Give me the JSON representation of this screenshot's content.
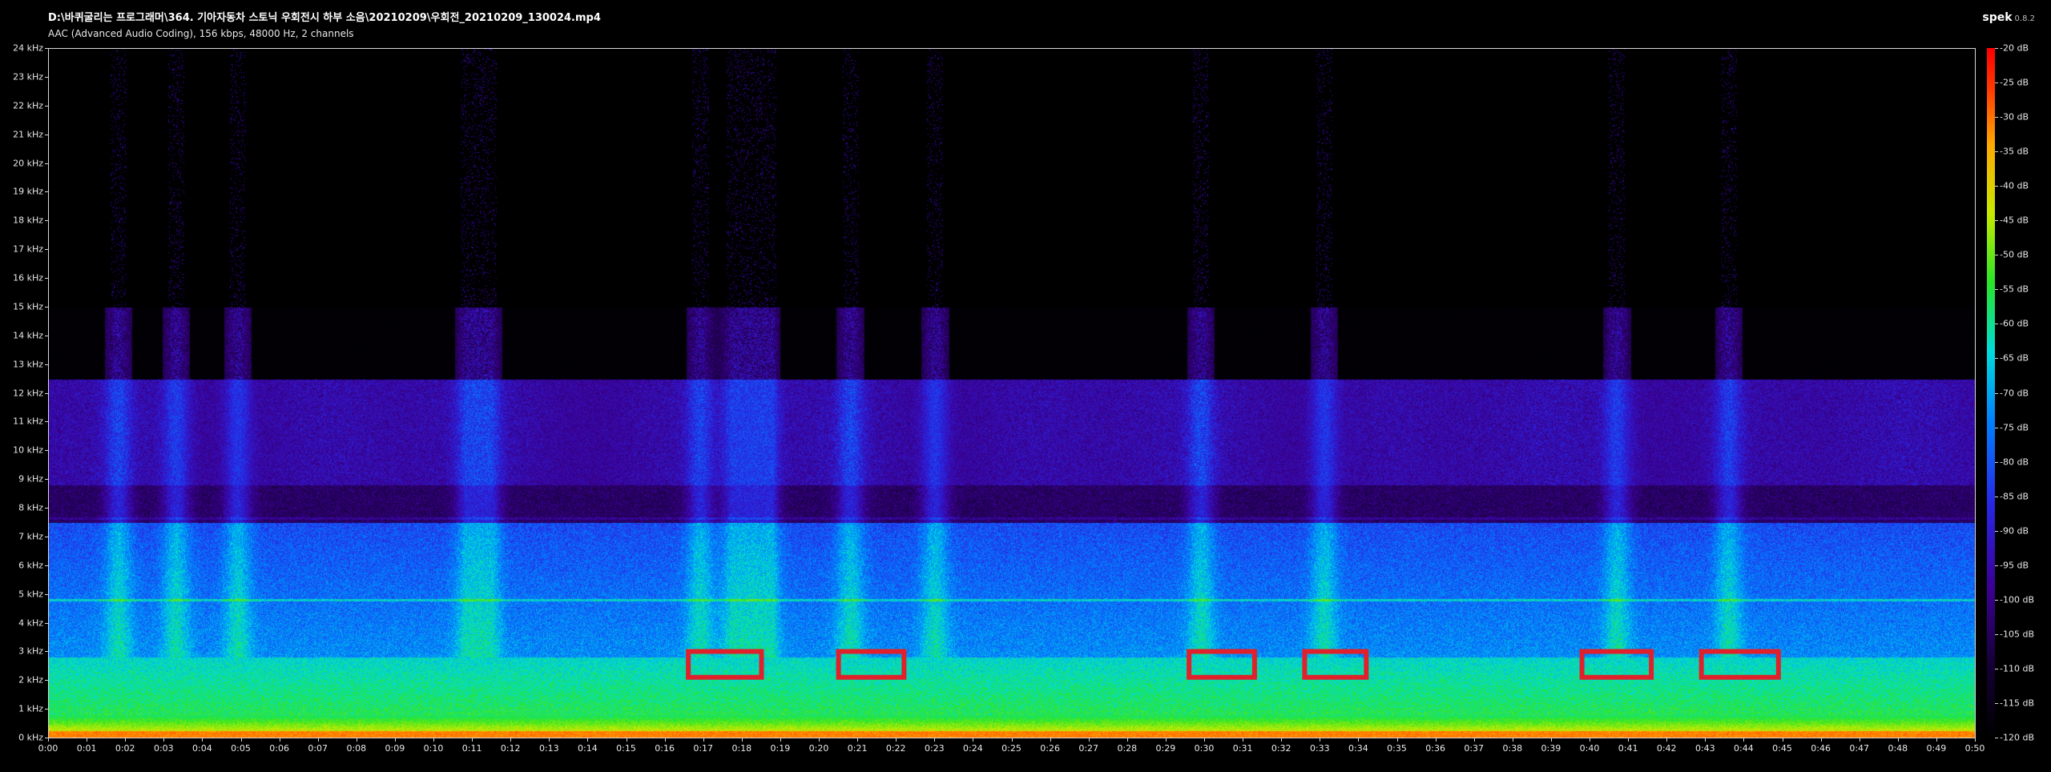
{
  "header": {
    "file_path": "D:\\바퀴굴리는 프로그래머\\364. 기아자동차 스토닉 우회전시 하부 소음\\20210209\\우회전_20210209_130024.mp4",
    "codec_info": "AAC (Advanced Audio Coding), 156 kbps, 48000 Hz, 2 channels"
  },
  "brand": {
    "name": "spek",
    "version": "0.8.2"
  },
  "chart_data": {
    "type": "heatmap",
    "title": "",
    "xlabel": "",
    "ylabel": "",
    "x_ticks": [
      "0:00",
      "0:01",
      "0:02",
      "0:03",
      "0:04",
      "0:05",
      "0:06",
      "0:07",
      "0:08",
      "0:09",
      "0:10",
      "0:11",
      "0:12",
      "0:13",
      "0:14",
      "0:15",
      "0:16",
      "0:17",
      "0:18",
      "0:19",
      "0:20",
      "0:21",
      "0:22",
      "0:23",
      "0:24",
      "0:25",
      "0:26",
      "0:27",
      "0:28",
      "0:29",
      "0:30",
      "0:31",
      "0:32",
      "0:33",
      "0:34",
      "0:35",
      "0:36",
      "0:37",
      "0:38",
      "0:39",
      "0:40",
      "0:41",
      "0:42",
      "0:43",
      "0:44",
      "0:45",
      "0:46",
      "0:47",
      "0:48",
      "0:49",
      "0:50"
    ],
    "y_ticks": [
      "0 kHz",
      "1 kHz",
      "2 kHz",
      "3 kHz",
      "4 kHz",
      "5 kHz",
      "6 kHz",
      "7 kHz",
      "8 kHz",
      "9 kHz",
      "10 kHz",
      "11 kHz",
      "12 kHz",
      "13 kHz",
      "14 kHz",
      "15 kHz",
      "16 kHz",
      "17 kHz",
      "18 kHz",
      "19 kHz",
      "20 kHz",
      "21 kHz",
      "22 kHz",
      "23 kHz",
      "24 kHz"
    ],
    "x_range_seconds": [
      0,
      50
    ],
    "y_range_khz": [
      0,
      24
    ],
    "colorbar_ticks": [
      "-20 dB",
      "-25 dB",
      "-30 dB",
      "-35 dB",
      "-40 dB",
      "-45 dB",
      "-50 dB",
      "-55 dB",
      "-60 dB",
      "-65 dB",
      "-70 dB",
      "-75 dB",
      "-80 dB",
      "-85 dB",
      "-90 dB",
      "-95 dB",
      "-100 dB",
      "-105 dB",
      "-110 dB",
      "-115 dB",
      "-120 dB"
    ],
    "colorbar_range_db": [
      -120,
      -20
    ],
    "events_seconds": [
      1.8,
      3.3,
      4.9,
      10.9,
      11.4,
      16.9,
      17.8,
      18.4,
      18.6,
      20.8,
      23.0,
      29.9,
      33.1,
      40.7,
      43.6
    ],
    "highlight_boxes": [
      {
        "t_start": 16.6,
        "t_end": 18.5,
        "f_low_khz": 2.1,
        "f_high_khz": 3.0,
        "color": "#e0202a"
      },
      {
        "t_start": 20.5,
        "t_end": 22.2,
        "f_low_khz": 2.1,
        "f_high_khz": 3.0,
        "color": "#e0202a"
      },
      {
        "t_start": 29.6,
        "t_end": 31.3,
        "f_low_khz": 2.1,
        "f_high_khz": 3.0,
        "color": "#e0202a"
      },
      {
        "t_start": 32.6,
        "t_end": 34.2,
        "f_low_khz": 2.1,
        "f_high_khz": 3.0,
        "color": "#e0202a"
      },
      {
        "t_start": 39.8,
        "t_end": 41.6,
        "f_low_khz": 2.1,
        "f_high_khz": 3.0,
        "color": "#e0202a"
      },
      {
        "t_start": 42.9,
        "t_end": 44.9,
        "f_low_khz": 2.1,
        "f_high_khz": 3.0,
        "color": "#e0202a"
      }
    ]
  },
  "colors": {
    "background": "#000000",
    "border": "#d8d8d8",
    "highlight": "#e0202a"
  }
}
